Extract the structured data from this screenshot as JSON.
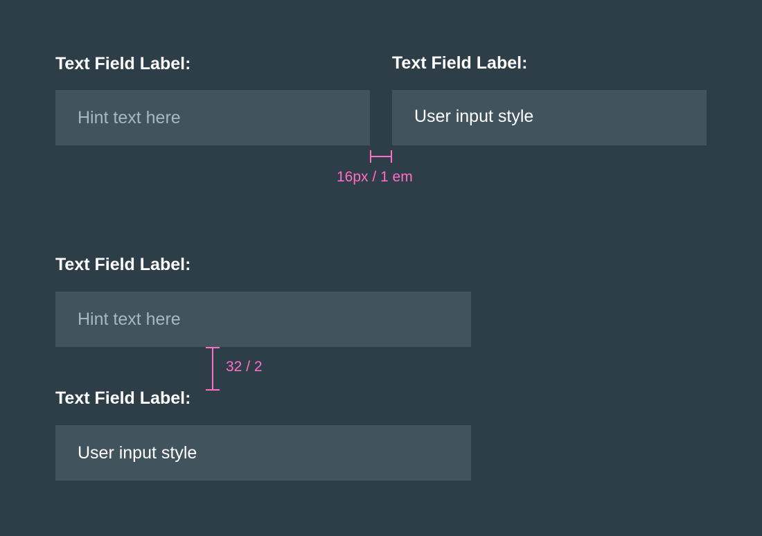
{
  "fields": {
    "top_left": {
      "label": "Text Field Label:",
      "placeholder": "Hint text here",
      "value": ""
    },
    "top_right": {
      "label": "Text Field Label:",
      "placeholder": "",
      "value": "User input style"
    },
    "middle": {
      "label": "Text Field Label:",
      "placeholder": "Hint text here",
      "value": ""
    },
    "bottom": {
      "label": "Text Field Label:",
      "placeholder": "",
      "value": "User input style"
    }
  },
  "annotations": {
    "horizontal_gap": "16px / 1 em",
    "vertical_gap": "32 / 2"
  },
  "colors": {
    "background": "#2e3e48",
    "field_background": "#41535c",
    "label_text": "#ffffff",
    "hint_text": "#a8b8c2",
    "annotation": "#ff6ec7"
  }
}
